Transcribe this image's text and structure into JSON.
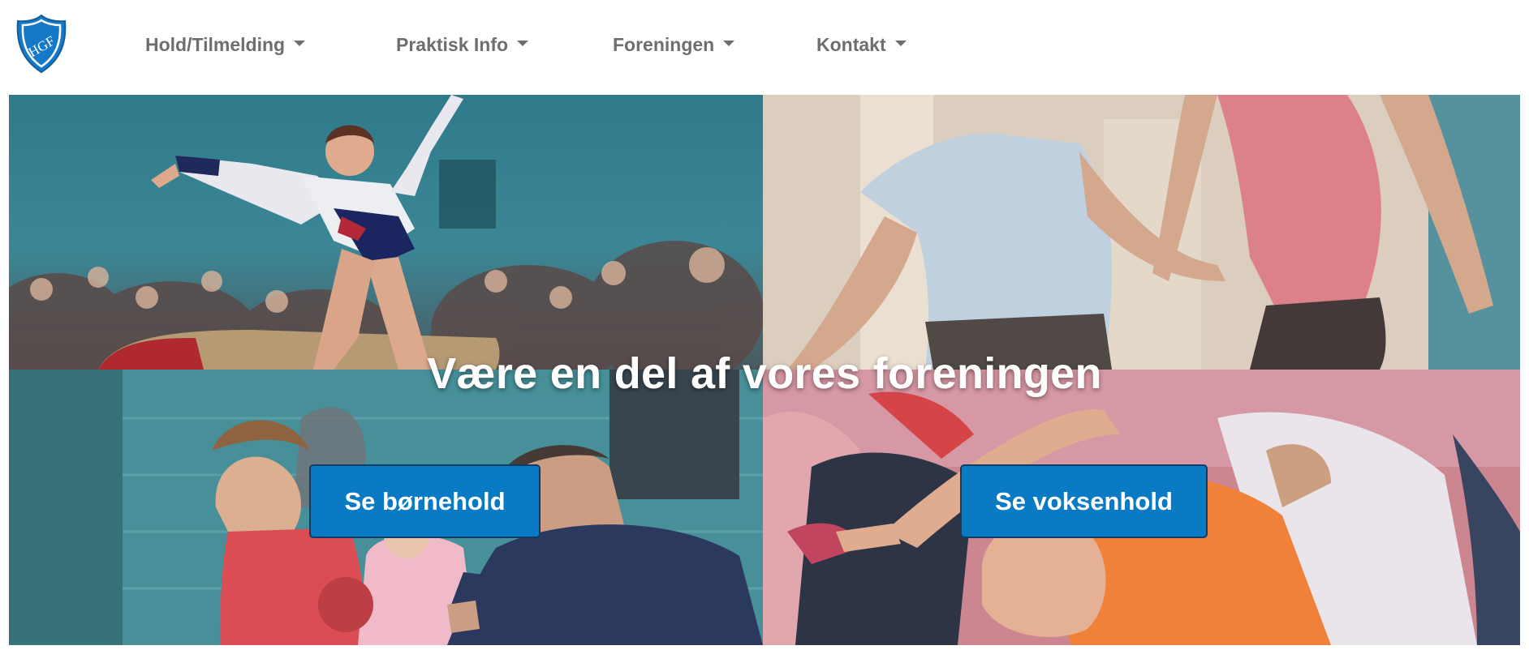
{
  "logo": {
    "text": "HGF"
  },
  "nav": {
    "items": [
      {
        "label": "Hold/Tilmelding"
      },
      {
        "label": "Praktisk Info"
      },
      {
        "label": "Foreningen"
      },
      {
        "label": "Kontakt"
      }
    ]
  },
  "hero": {
    "title": "Være en del af vores foreningen",
    "buttons": {
      "children": "Se børnehold",
      "adults": "Se voksenhold"
    }
  },
  "colors": {
    "nav_text": "#6e6e6e",
    "logo_blue": "#1679c8",
    "button_blue": "#0a7ac4",
    "button_border": "#0b3d66"
  }
}
